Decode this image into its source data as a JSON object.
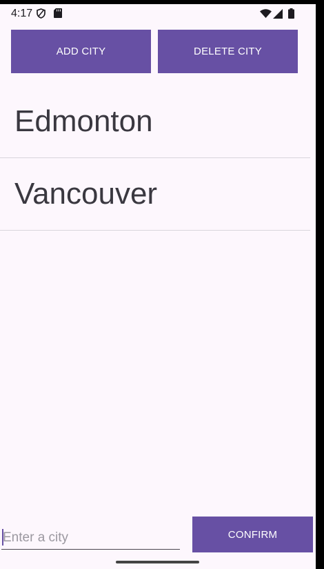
{
  "status_bar": {
    "time": "4:17",
    "icons_left": [
      "shield-icon",
      "sd-card-icon"
    ],
    "icons_right": [
      "wifi-icon",
      "signal-icon",
      "battery-icon"
    ]
  },
  "toolbar": {
    "add_label": "ADD CITY",
    "delete_label": "DELETE CITY"
  },
  "city_list": [
    {
      "name": "Edmonton"
    },
    {
      "name": "Vancouver"
    }
  ],
  "input": {
    "placeholder": "Enter a city",
    "value": ""
  },
  "confirm_label": "CONFIRM",
  "colors": {
    "accent": "#6750A4",
    "background": "#FDF7FD",
    "divider": "#D9D5DC",
    "text": "#3A3840"
  }
}
